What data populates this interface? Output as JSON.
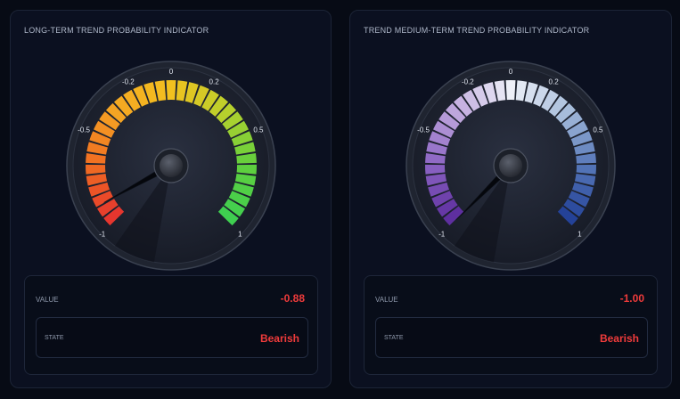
{
  "gauges": [
    {
      "title": "LONG-TERM TREND PROBABILITY INDICATOR",
      "value_label": "VALUE",
      "value_text": "-0.88",
      "value": -0.88,
      "state_label": "STATE",
      "state_text": "Bearish",
      "ticks": [
        "-1",
        "-0.5",
        "-0.2",
        "0",
        "0.2",
        "0.5",
        "1"
      ],
      "color_stops": [
        "#e5312f",
        "#f06b22",
        "#f5a623",
        "#f2c11f",
        "#b9d12c",
        "#5fcf3e",
        "#3ccf52"
      ],
      "value_color": "#ef3b3b"
    },
    {
      "title": "TREND MEDIUM-TERM TREND PROBABILITY INDICATOR",
      "value_label": "VALUE",
      "value_text": "-1.00",
      "value": -1.0,
      "state_label": "STATE",
      "state_text": "Bearish",
      "ticks": [
        "-1",
        "-0.5",
        "-0.2",
        "0",
        "0.2",
        "0.5",
        "1"
      ],
      "color_stops": [
        "#5a2a9c",
        "#8a62c2",
        "#c0a8dd",
        "#eef0f8",
        "#a9bfdc",
        "#5576b8",
        "#1f3d95"
      ],
      "value_color": "#ef3b3b"
    }
  ]
}
